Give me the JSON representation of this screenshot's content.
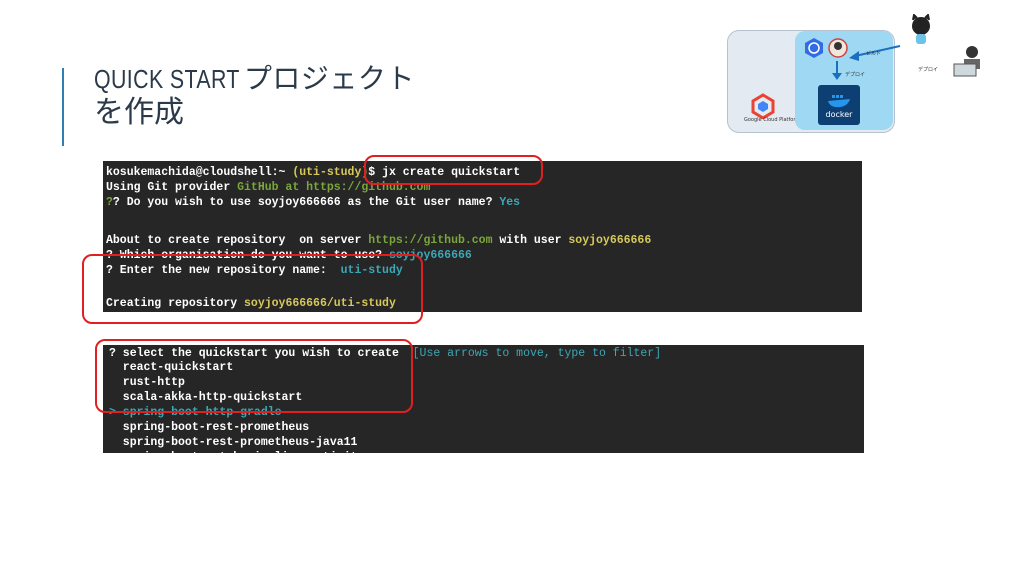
{
  "title": {
    "line1_en": "QUICK START",
    "line1_jp": "プロジェクト",
    "line2": "を作成"
  },
  "terminal1": {
    "line1": {
      "prompt": "kosukemachida@cloudshell:~ ",
      "project": "(uti-study)",
      "command": "$ jx create quickstart"
    },
    "line2": {
      "text": "Using Git provider ",
      "provider": "GitHub at https://github.com"
    },
    "line3": {
      "text": "? Do you wish to use soyjoy666666 as the Git user name? ",
      "answer": "Yes"
    },
    "line4": {
      "text": "About to create repository  on server ",
      "server": "https://github.com",
      "mid": " with user ",
      "user": "soyjoy666666"
    },
    "line5": {
      "text": "? Which organisation do you want to use? ",
      "answer": "soyjoy666666"
    },
    "line6": {
      "text": "? Enter the new repository name:  ",
      "answer": "uti-study"
    },
    "line7": {
      "text": "Creating repository ",
      "repo": "soyjoy666666/uti-study"
    }
  },
  "terminal2": {
    "prompt": "? select the quickstart you wish to create  ",
    "hint": "[Use arrows to move, type to filter]",
    "options": [
      "  react-quickstart",
      "  rust-http",
      "  scala-akka-http-quickstart",
      "> spring-boot-http-gradle",
      "  spring-boot-rest-prometheus",
      "  spring-boot-rest-prometheus-java11",
      "  spring-boot-watch-pipeline-activity"
    ]
  },
  "diagram": {
    "platform_label": "Google Cloud Platform",
    "docker_label": "docker",
    "arrow_label1": "ビルド",
    "arrow_label2": "デプロイ",
    "user_label": "デプロイ"
  },
  "colors": {
    "accent": "#2f7fb0",
    "highlight": "#e02020",
    "terminal_bg": "#262626"
  }
}
